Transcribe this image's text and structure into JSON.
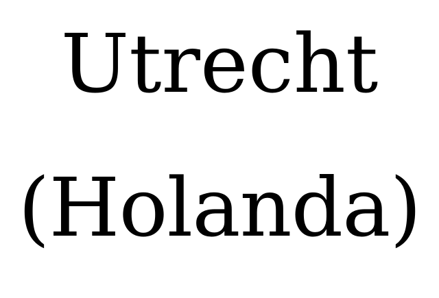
{
  "lines": [
    "Utrecht",
    "(Holanda)"
  ],
  "colors": {
    "text": "#000000",
    "background": "#ffffff"
  }
}
